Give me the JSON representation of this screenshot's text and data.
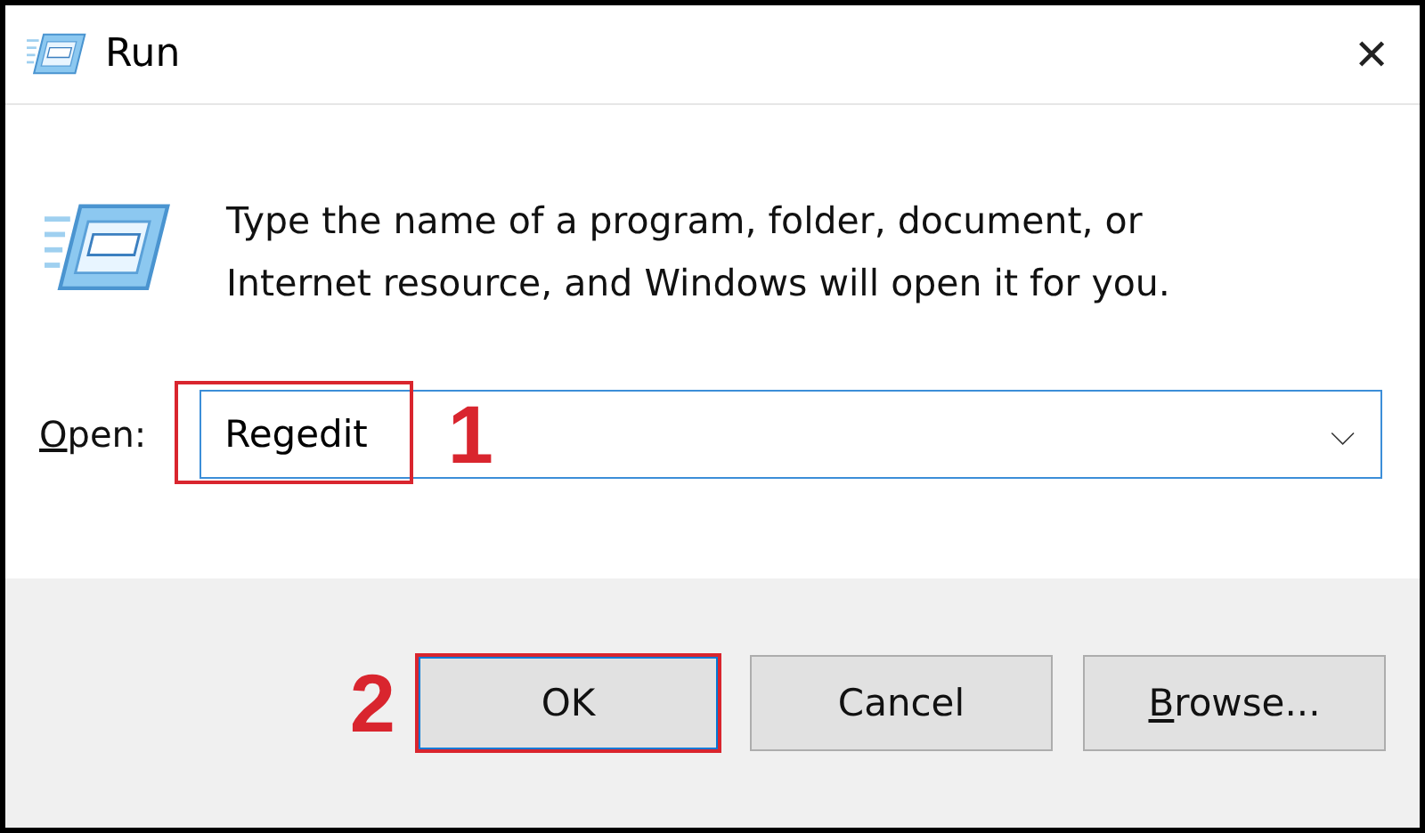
{
  "window": {
    "title": "Run",
    "close": "✕"
  },
  "message": "Type the name of a program, folder, document, or Internet resource, and Windows will open it for you.",
  "open_field": {
    "label": "Open:",
    "underline_first": true,
    "value": "Regedit",
    "dropdown": "⌵",
    "annotation": "1"
  },
  "buttons": [
    {
      "label": "OK",
      "default": true,
      "underline_first": false,
      "annotation": "2"
    },
    {
      "label": "Cancel",
      "default": false,
      "underline_first": false
    },
    {
      "label": "Browse...",
      "default": false,
      "underline_first": true
    }
  ]
}
